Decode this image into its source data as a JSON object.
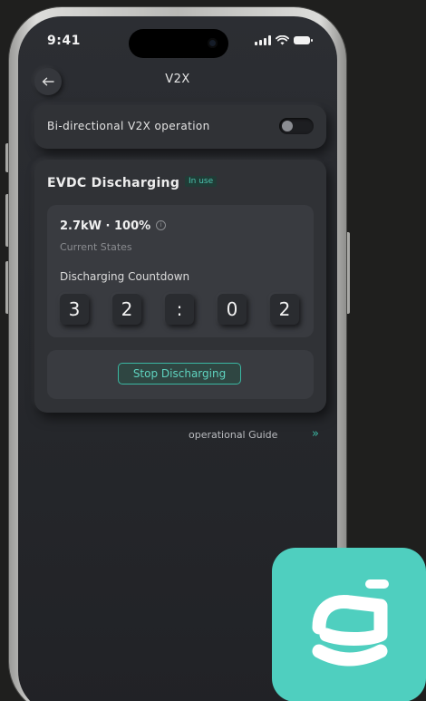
{
  "status_bar": {
    "time": "9:41"
  },
  "header": {
    "title": "V2X"
  },
  "v2x_toggle": {
    "label": "Bi-directional V2X operation",
    "enabled": false
  },
  "discharging": {
    "title": "EVDC Discharging",
    "badge": "In use",
    "power_stat": "2.7kW · 100%",
    "state_label": "Current States",
    "countdown_label": "Discharging Countdown",
    "countdown_digits": [
      "3",
      "2",
      ":",
      "0",
      "2"
    ],
    "stop_button": "Stop Discharging"
  },
  "guide": {
    "label": "operational Guide",
    "chevron": "»"
  },
  "colors": {
    "accent": "#3bb7a2",
    "logo_bg": "#4fcfbf",
    "card_bg": "#303236",
    "screen_bg": "#26282c"
  },
  "icons": {
    "back": "arrow-left-icon",
    "info": "info-icon",
    "signal": "cellular-signal-icon",
    "wifi": "wifi-icon",
    "battery": "battery-icon",
    "logo": "app-logo-icon"
  }
}
